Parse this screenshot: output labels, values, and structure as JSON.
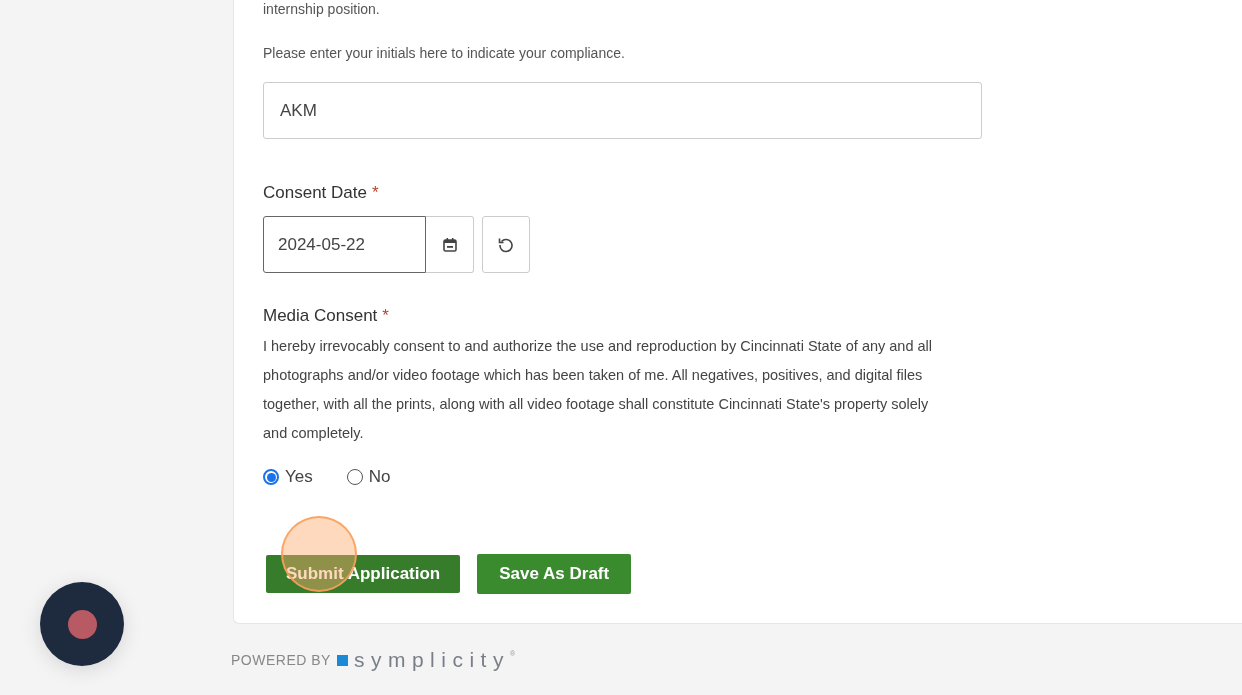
{
  "form": {
    "cut_text": "internship position.",
    "initials": {
      "prompt": "Please enter your initials here to indicate your compliance.",
      "value": "AKM"
    },
    "consent_date": {
      "label": "Consent Date",
      "required_mark": "*",
      "value": "2024-05-22"
    },
    "media_consent": {
      "label": "Media Consent",
      "required_mark": "*",
      "text": "I hereby irrevocably consent to and authorize the use and reproduction by Cincinnati State of any and all photographs and/or video footage which has been taken of me. All negatives, positives, and digital files together, with all the prints, along with all video footage shall constitute Cincinnati State's property solely and completely.",
      "options": [
        {
          "label": "Yes",
          "selected": true
        },
        {
          "label": "No",
          "selected": false
        }
      ]
    },
    "buttons": [
      {
        "label": "Submit Application"
      },
      {
        "label": "Save As Draft"
      }
    ]
  },
  "footer": {
    "powered_by": "POWERED BY",
    "brand": "symplicity",
    "brand_mark": "®"
  }
}
